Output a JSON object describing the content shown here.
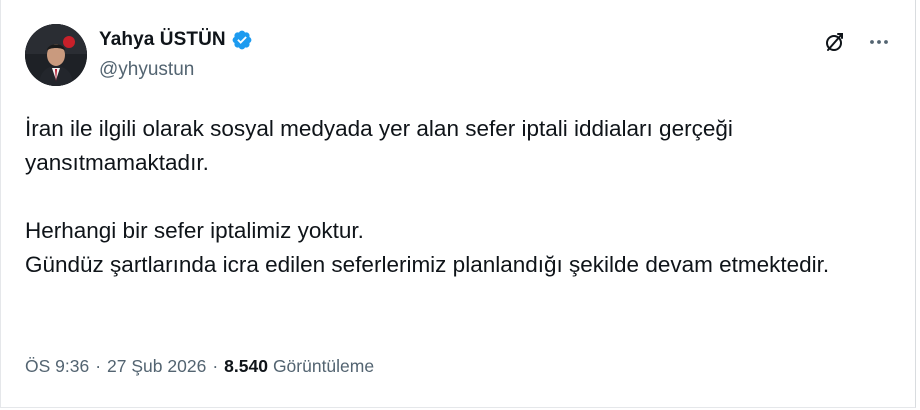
{
  "author": {
    "display_name": "Yahya ÜSTÜN",
    "handle": "@yhyustun",
    "verified": true,
    "verified_color": "#1d9bf0",
    "avatar": "avatar-photo"
  },
  "header_icons": [
    "grok-icon",
    "more-icon"
  ],
  "tweet": {
    "paragraphs": [
      "İran ile ilgili olarak sosyal medyada yer alan sefer iptali iddiaları gerçeği yansıtmamaktadır.",
      "",
      "Herhangi bir sefer iptalimiz yoktur.",
      "Gündüz şartlarında icra edilen seferlerimiz planlandığı şekilde devam etmektedir."
    ]
  },
  "meta": {
    "time": "ÖS 9:36",
    "separator": "·",
    "date": "27 Şub 2026",
    "views_count": "8.540",
    "views_label": "Görüntüleme"
  },
  "colors": {
    "text": "#0f1419",
    "secondary": "#536471",
    "accent": "#1d9bf0"
  }
}
